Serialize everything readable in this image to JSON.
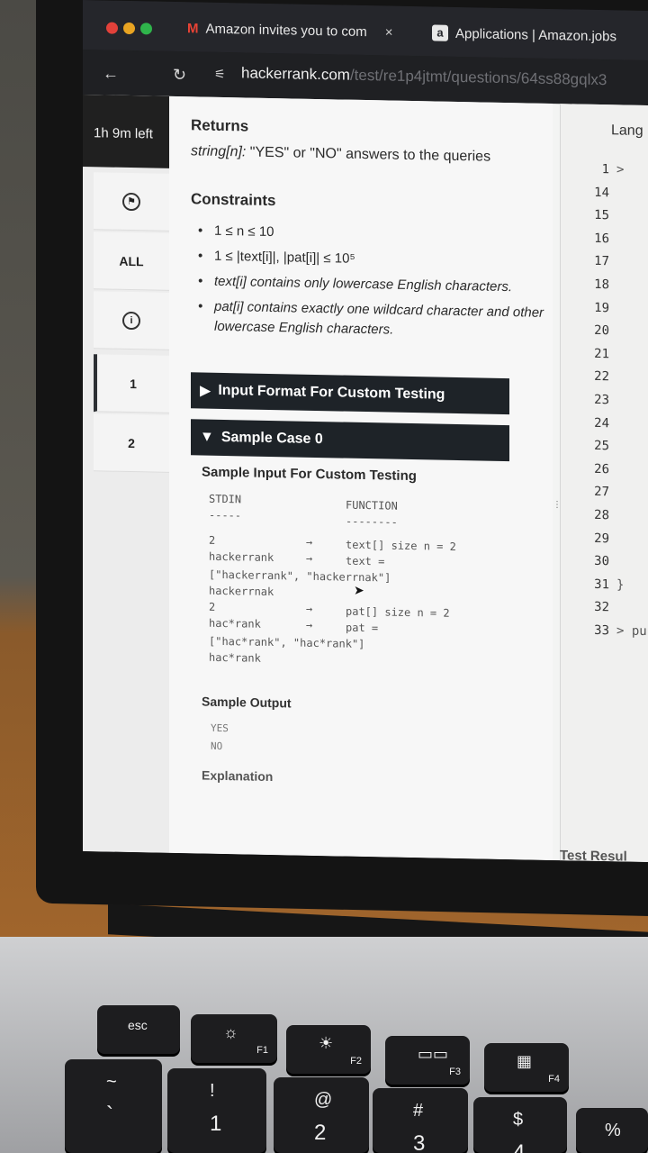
{
  "browser": {
    "tabs": [
      {
        "label": "Amazon invites you to com",
        "icon": "gmail-icon"
      },
      {
        "label": "Applications | Amazon.jobs",
        "icon": "amazon-icon"
      }
    ],
    "close_glyph": "×",
    "url_host": "hackerrank.com",
    "url_path": "/test/re1p4jtmt/questions/64ss88gqlx3"
  },
  "sidebar": {
    "timer": "1h 9m left",
    "items": [
      {
        "label": "",
        "icon": "flag-icon"
      },
      {
        "label": "ALL"
      },
      {
        "label": "",
        "icon": "info-icon"
      },
      {
        "label": "1"
      },
      {
        "label": "2"
      }
    ]
  },
  "problem": {
    "returns_heading": "Returns",
    "returns_type": "string[n]:",
    "returns_desc": " \"YES\" or \"NO\" answers to the queries",
    "constraints_heading": "Constraints",
    "constraints": [
      "1 ≤ n ≤ 10",
      "1 ≤ |text[i]|, |pat[i]| ≤ 10⁵",
      "text[i] contains only lowercase English characters.",
      "pat[i] contains exactly one wildcard character and other lowercase English characters."
    ],
    "accordion_input_format": "Input Format For Custom Testing",
    "accordion_sample_case": "Sample Case 0",
    "sample_input_title": "Sample Input For Custom Testing",
    "code_header_left": "STDIN",
    "code_header_right": "FUNCTION",
    "code_rule_left": "-----",
    "code_rule_right": "--------",
    "code_lines": [
      {
        "left": "2",
        "arrow": "→",
        "fn": "text[] size n = 2"
      },
      {
        "left": "hackerrank",
        "arrow": "→",
        "fn": "text ="
      },
      {
        "left": "[\"hackerrank\", \"hackerrnak\"]",
        "arrow": "",
        "fn": ""
      },
      {
        "left": "hackerrnak",
        "arrow": "",
        "fn": ""
      },
      {
        "left": "2",
        "arrow": "→",
        "fn": "pat[] size n = 2"
      },
      {
        "left": "hac*rank",
        "arrow": "→",
        "fn": "pat ="
      },
      {
        "left": "[\"hac*rank\", \"hac*rank\"]",
        "arrow": "",
        "fn": ""
      },
      {
        "left": "hac*rank",
        "arrow": "",
        "fn": ""
      }
    ],
    "sample_output_title": "Sample Output",
    "sample_output": [
      "YES",
      "NO"
    ],
    "explanation_title": "Explanation"
  },
  "editor": {
    "language_label": "Lang",
    "lines": [
      {
        "n": "1",
        "tok": ">"
      },
      {
        "n": "14",
        "tok": ""
      },
      {
        "n": "15",
        "tok": ""
      },
      {
        "n": "16",
        "tok": ""
      },
      {
        "n": "17",
        "tok": ""
      },
      {
        "n": "18",
        "tok": ""
      },
      {
        "n": "19",
        "tok": ""
      },
      {
        "n": "20",
        "tok": ""
      },
      {
        "n": "21",
        "tok": ""
      },
      {
        "n": "22",
        "tok": ""
      },
      {
        "n": "23",
        "tok": ""
      },
      {
        "n": "24",
        "tok": ""
      },
      {
        "n": "25",
        "tok": ""
      },
      {
        "n": "26",
        "tok": ""
      },
      {
        "n": "27",
        "tok": ""
      },
      {
        "n": "28",
        "tok": ""
      },
      {
        "n": "29",
        "tok": ""
      },
      {
        "n": "30",
        "tok": ""
      },
      {
        "n": "31",
        "tok": "}"
      },
      {
        "n": "32",
        "tok": ""
      },
      {
        "n": "33",
        "tok": "> pub"
      }
    ],
    "test_results_label": "Test Resul"
  },
  "keyboard": {
    "keys": [
      {
        "label": "esc",
        "name": "esc-key"
      },
      {
        "label": "F1",
        "glyph": "☼",
        "name": "f1-key"
      },
      {
        "label": "F2",
        "glyph": "☀",
        "name": "f2-key"
      },
      {
        "label": "F3",
        "glyph": "▭▭",
        "name": "f3-key"
      },
      {
        "label": "F4",
        "glyph": "▦",
        "name": "f4-key"
      },
      {
        "label": "~",
        "sub": "`",
        "name": "tilde-key"
      },
      {
        "label": "!",
        "sub": "1",
        "name": "key-1"
      },
      {
        "label": "@",
        "sub": "2",
        "name": "key-2"
      },
      {
        "label": "#",
        "sub": "3",
        "name": "key-3"
      },
      {
        "label": "$",
        "sub": "4",
        "name": "key-4"
      },
      {
        "label": "%",
        "sub": "",
        "name": "key-5"
      }
    ]
  }
}
